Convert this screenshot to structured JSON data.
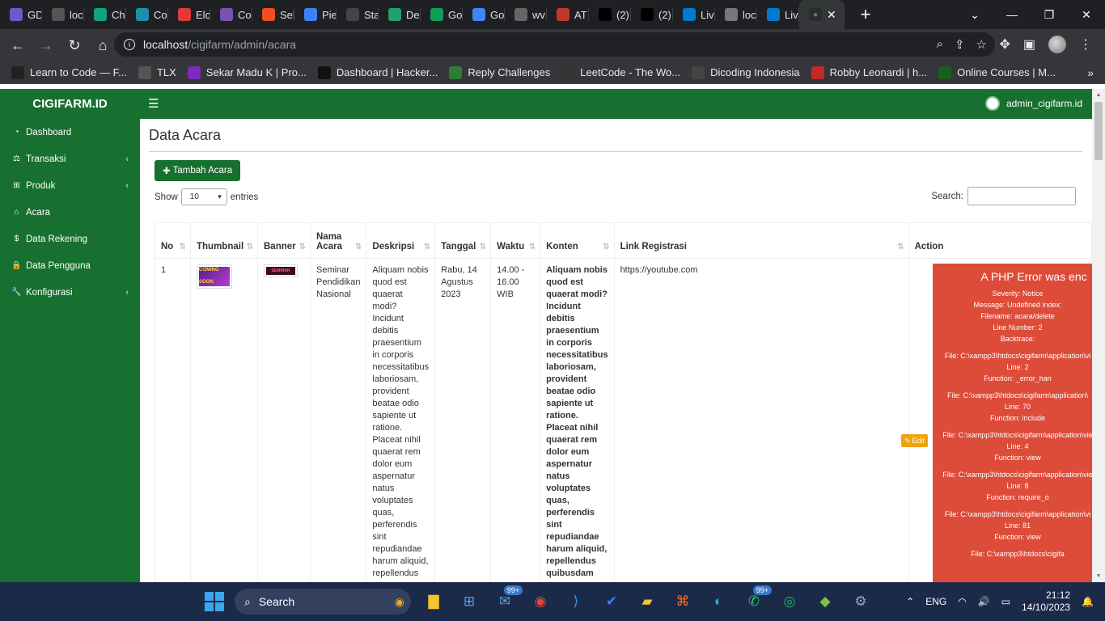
{
  "browser": {
    "tabs": [
      {
        "label": "GD",
        "color": "#6a5acd"
      },
      {
        "label": "loc",
        "color": "#555"
      },
      {
        "label": "Ch",
        "color": "#10a37f"
      },
      {
        "label": "Co",
        "color": "#1e8fa8"
      },
      {
        "label": "Elo",
        "color": "#e03a3e"
      },
      {
        "label": "Co",
        "color": "#7952b3"
      },
      {
        "label": "Sel",
        "color": "#f24e1e"
      },
      {
        "label": "Pie",
        "color": "#3b82f6"
      },
      {
        "label": "Sta",
        "color": "#444"
      },
      {
        "label": "De",
        "color": "#22a06b"
      },
      {
        "label": "Go",
        "color": "#0f9d58"
      },
      {
        "label": "Go",
        "color": "#4285f4"
      },
      {
        "label": "wv",
        "color": "#666"
      },
      {
        "label": "AT",
        "color": "#c0392b"
      },
      {
        "label": "(2)",
        "color": "#000"
      },
      {
        "label": "(2)",
        "color": "#000"
      },
      {
        "label": "Liv",
        "color": "#007acc"
      },
      {
        "label": "loc",
        "color": "#777"
      },
      {
        "label": "Liv",
        "color": "#007acc"
      }
    ],
    "active_tab_close": "✕",
    "url_host": "localhost",
    "url_path": "/cigifarm/admin/acara",
    "bookmarks": [
      {
        "label": "Learn to Code — F...",
        "color": "#222"
      },
      {
        "label": "TLX",
        "color": "#555"
      },
      {
        "label": "Sekar Madu K | Pro...",
        "color": "#7b2cbf"
      },
      {
        "label": "Dashboard | Hacker...",
        "color": "#111"
      },
      {
        "label": "Reply Challenges",
        "color": "#2e7d32"
      },
      {
        "label": "LeetCode - The Wo...",
        "color": "#333"
      },
      {
        "label": "Dicoding Indonesia",
        "color": "#444"
      },
      {
        "label": "Robby Leonardi | h...",
        "color": "#c62828"
      },
      {
        "label": "Online Courses | M...",
        "color": "#1b5e20"
      }
    ]
  },
  "app": {
    "brand": "CIGIFARM.ID",
    "user": "admin_cigifarm.id",
    "sidebar": [
      {
        "label": "Dashboard",
        "icon": "dashboard-icon",
        "glyph": "◔",
        "chevron": false
      },
      {
        "label": "Transaksi",
        "icon": "scale-icon",
        "glyph": "⚖",
        "chevron": true
      },
      {
        "label": "Produk",
        "icon": "sitemap-icon",
        "glyph": "⊞",
        "chevron": true
      },
      {
        "label": "Acara",
        "icon": "home-icon",
        "glyph": "⌂",
        "chevron": false
      },
      {
        "label": "Data Rekening",
        "icon": "dollar-icon",
        "glyph": "$",
        "chevron": false
      },
      {
        "label": "Data Pengguna",
        "icon": "lock-icon",
        "glyph": "🔒",
        "chevron": false
      },
      {
        "label": "Konfigurasi",
        "icon": "wrench-icon",
        "glyph": "🔧",
        "chevron": true
      }
    ],
    "page_title": "Data Acara",
    "add_button": "Tambah Acara",
    "show_label": "Show",
    "entries_value": "10",
    "entries_label": "entries",
    "search_label": "Search:",
    "table": {
      "headers": [
        "No",
        "Thumbnail",
        "Banner",
        "Nama Acara",
        "Deskripsi",
        "Tanggal",
        "Waktu",
        "Konten",
        "Link Registrasi",
        "Action"
      ],
      "row": {
        "no": "1",
        "thumbnail_text": "COMING SOON",
        "banner_text": "SEMINAR",
        "nama": "Seminar Pendidikan Nasional",
        "deskripsi": "Aliquam nobis quod est quaerat modi? Incidunt debitis praesentium in corporis necessitatibus laboriosam, provident beatae odio sapiente ut ratione. Placeat nihil quaerat rem dolor eum aspernatur natus voluptates quas, perferendis sint repudiandae harum aliquid, repellendus",
        "tanggal": "Rabu, 14 Agustus 2023",
        "waktu": "14.00 - 16.00 WIB",
        "konten": "Aliquam nobis quod est quaerat modi? Incidunt debitis praesentium in corporis necessitatibus laboriosam, provident beatae odio sapiente ut ratione. Placeat nihil quaerat rem dolor eum aspernatur natus voluptates quas, perferendis sint repudiandae harum aliquid, repellendus quibusdam",
        "link": "https://youtube.com",
        "edit": "Edit"
      }
    },
    "php_error": {
      "title": "A PHP Error was enc",
      "lines": [
        "Severity: Notice",
        "Message: Undefined index:",
        "Filename: acara/delete",
        "Line Number: 2",
        "Backtrace:",
        "File: C:\\xampp3\\htdocs\\cigifarm\\application\\vi",
        "Line: 2",
        "Function: _error_han",
        "File: C:\\xampp3\\htdocs\\cigifarm\\application\\",
        "Line: 70",
        "Function: include",
        "File: C:\\xampp3\\htdocs\\cigifarm\\application\\vie",
        "Line: 4",
        "Function: view",
        "File: C:\\xampp3\\htdocs\\cigifarm\\application\\vie",
        "Line: 8",
        "Function: require_o",
        "File: C:\\xampp3\\htdocs\\cigifarm\\application\\vi",
        "Line: 81",
        "Function: view",
        "File: C:\\xampp3\\htdocs\\cigifa"
      ]
    }
  },
  "taskbar": {
    "search": "Search",
    "badge1": "99+",
    "badge2": "99+",
    "lang": "ENG",
    "time": "21:12",
    "date": "14/10/2023"
  }
}
